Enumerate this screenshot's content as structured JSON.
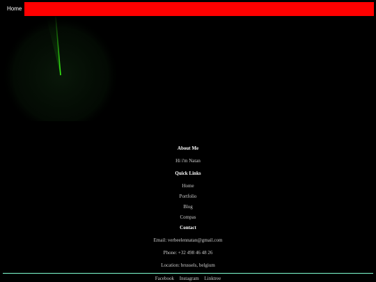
{
  "nav": {
    "home_label": "Home"
  },
  "colors": {
    "banner": "#ff0000",
    "radar_sweep": "#39ff14",
    "divider": "#7fffd4",
    "background": "#000000"
  },
  "footer": {
    "about": {
      "heading": "About Me",
      "text": "Hi i'm Natan"
    },
    "quick_links": {
      "heading": "Quick Links",
      "items": [
        "Home",
        "Portfolio",
        "Blog",
        "Compas"
      ]
    },
    "contact": {
      "heading": "Contact",
      "email": "Email: verbeelennatan@gmail.com",
      "phone": "Phone: +32 498 46 48 26",
      "location": "Location: brussels, belgium"
    },
    "social": [
      "Facebook",
      "Instagram",
      "Linktree"
    ]
  }
}
